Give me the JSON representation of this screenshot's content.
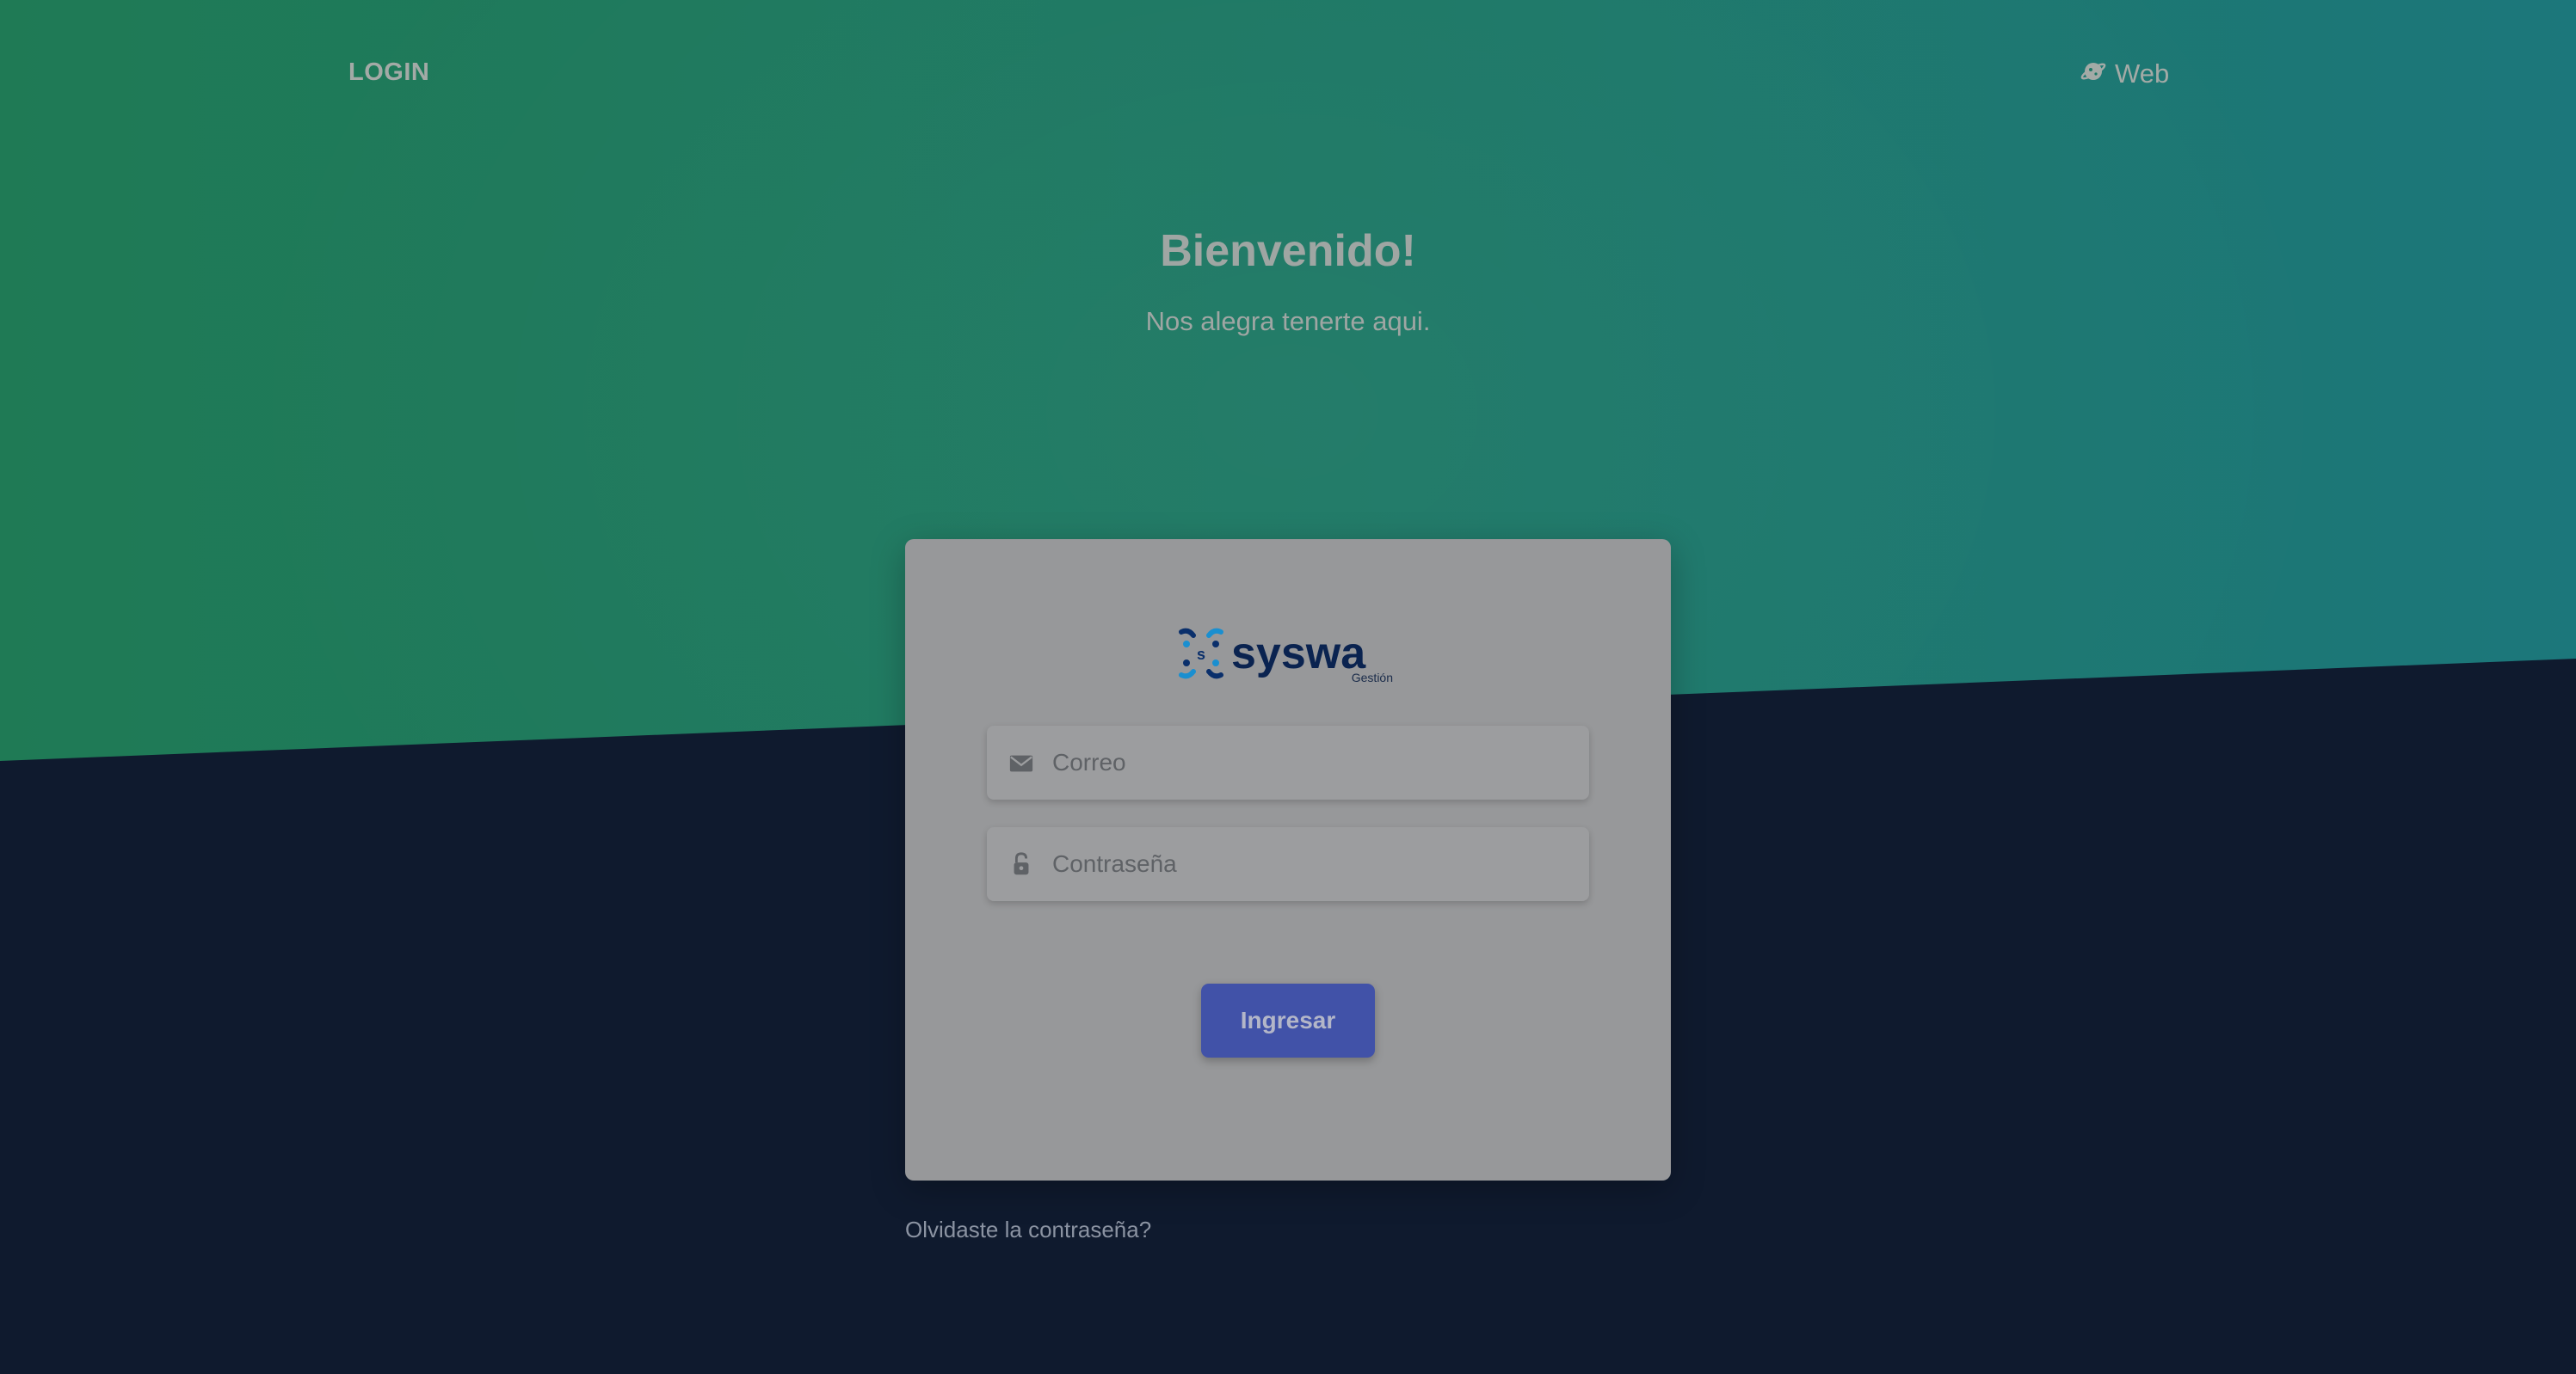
{
  "nav": {
    "brand": "LOGIN",
    "web_link": "Web",
    "web_icon": "planet-icon"
  },
  "hero": {
    "title": "Bienvenido!",
    "subtitle": "Nos alegra tenerte aqui."
  },
  "login_card": {
    "logo_text": "syswa",
    "logo_subtext": "Gestión",
    "email_placeholder": "Correo",
    "email_icon": "envelope-icon",
    "password_placeholder": "Contraseña",
    "password_icon": "unlock-icon",
    "submit_label": "Ingresar"
  },
  "forgot_link": "Olvidaste la contraseña?",
  "colors": {
    "top_background": "#1f7a55",
    "bottom_background": "#0f1a2e",
    "button": "#4152a8",
    "card": "#97989a"
  }
}
